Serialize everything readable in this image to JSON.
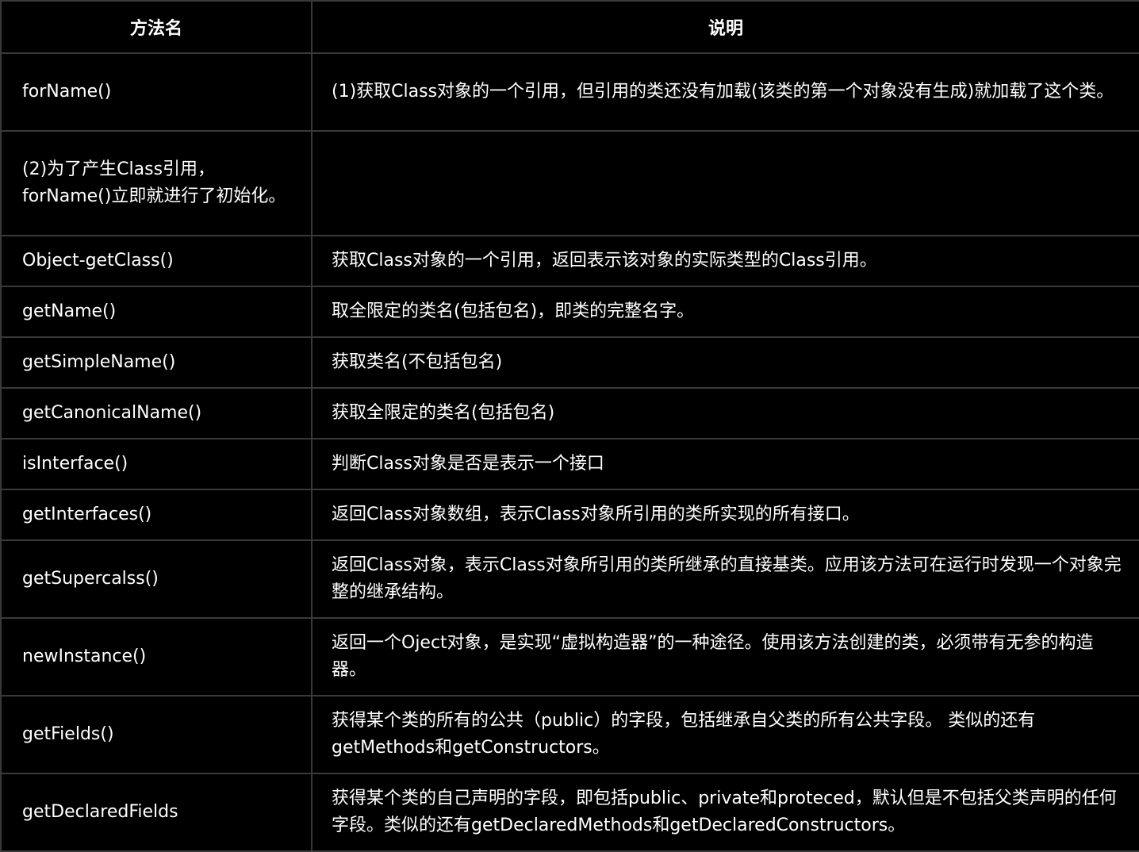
{
  "table": {
    "headers": {
      "name": "方法名",
      "description": "说明"
    },
    "rows": [
      {
        "name": "forName()",
        "description": "(1)获取Class对象的一个引用，但引用的类还没有加载(该类的第一个对象没有生成)就加载了这个类。"
      },
      {
        "name": "(2)为了产生Class引用，forName()立即就进行了初始化。",
        "description": ""
      },
      {
        "name": "Object-getClass()",
        "description": "获取Class对象的一个引用，返回表示该对象的实际类型的Class引用。"
      },
      {
        "name": "getName()",
        "description": "取全限定的类名(包括包名)，即类的完整名字。"
      },
      {
        "name": "getSimpleName()",
        "description": "获取类名(不包括包名)"
      },
      {
        "name": "getCanonicalName()",
        "description": "获取全限定的类名(包括包名)"
      },
      {
        "name": "isInterface()",
        "description": "判断Class对象是否是表示一个接口"
      },
      {
        "name": "getInterfaces()",
        "description": "返回Class对象数组，表示Class对象所引用的类所实现的所有接口。"
      },
      {
        "name": "getSupercalss()",
        "description": "返回Class对象，表示Class对象所引用的类所继承的直接基类。应用该方法可在运行时发现一个对象完整的继承结构。"
      },
      {
        "name": "newInstance()",
        "description": "返回一个Oject对象，是实现“虚拟构造器”的一种途径。使用该方法创建的类，必须带有无参的构造器。"
      },
      {
        "name": "getFields()",
        "description": "获得某个类的所有的公共（public）的字段，包括继承自父类的所有公共字段。 类似的还有getMethods和getConstructors。"
      },
      {
        "name": "getDeclaredFields",
        "description": "获得某个类的自己声明的字段，即包括public、private和proteced，默认但是不包括父类声明的任何字段。类似的还有getDeclaredMethods和getDeclaredConstructors。"
      }
    ]
  }
}
